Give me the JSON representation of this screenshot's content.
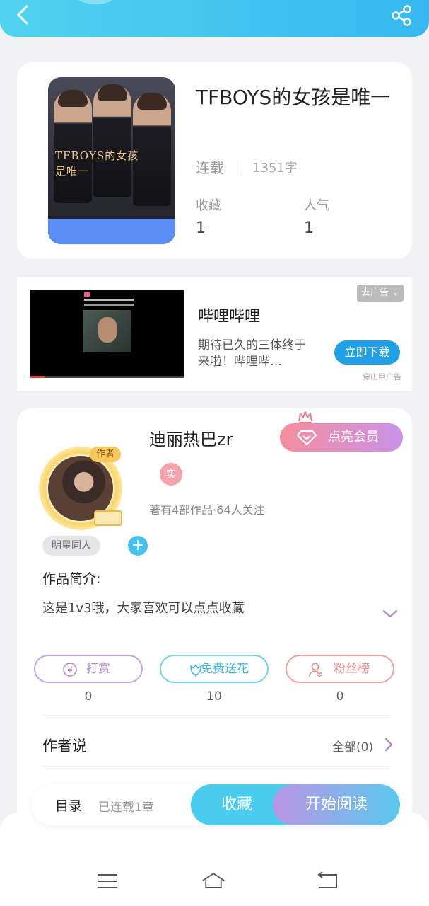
{
  "header": {
    "back_icon": "chevron-left-icon",
    "share_icon": "share-icon"
  },
  "book": {
    "cover_title": "TFBOYS的女孩是唯一",
    "title": "TFBOYS的女孩是唯一",
    "status": "连载",
    "word_count": "1351字",
    "stats": [
      {
        "label": "收藏",
        "value": "1"
      },
      {
        "label": "人气",
        "value": "1"
      }
    ]
  },
  "ad": {
    "close_label": "去广告",
    "app_name": "哔哩哔哩",
    "description": "期待已久的三体终于来啦！哔哩哔…",
    "cta": "立即下载",
    "source": "穿山甲广告"
  },
  "author": {
    "avatar_tag": "作者",
    "name": "迪丽热巴zr",
    "vip_button": "点亮会员",
    "real_badge": "实",
    "meta": "著有4部作品·64人关注",
    "tag": "明星同人",
    "add_tag": "+",
    "intro_label": "作品简介:",
    "intro": "这是1v3哦，大家喜欢可以点点收藏",
    "actions": [
      {
        "label": "打赏",
        "count": "0",
        "icon": "yen-coin-icon",
        "color": "#b58ad0"
      },
      {
        "label": "免费送花",
        "count": "10",
        "icon": "flower-icon",
        "color": "#3bbadc"
      },
      {
        "label": "粉丝榜",
        "count": "0",
        "icon": "fans-user-icon",
        "color": "#e58a8a"
      }
    ],
    "author_says_label": "作者说",
    "all_link": "全部(0)"
  },
  "bottom_bar": {
    "toc_label": "目录",
    "toc_status": "已连载1章",
    "collect_button": "收藏",
    "read_button": "开始阅读"
  },
  "system_nav": {
    "menu_icon": "menu-icon",
    "home_icon": "home-icon",
    "back_icon": "back-icon"
  }
}
